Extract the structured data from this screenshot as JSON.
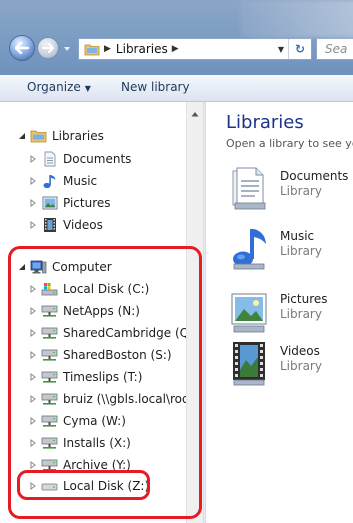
{
  "address": {
    "breadcrumb": "Libraries",
    "search_placeholder": "Sea"
  },
  "toolbar": {
    "organize_label": "Organize",
    "new_library_label": "New library"
  },
  "navigation": {
    "libraries": {
      "label": "Libraries",
      "children": [
        "Documents",
        "Music",
        "Pictures",
        "Videos"
      ]
    },
    "computer": {
      "label": "Computer",
      "drives": [
        "Local Disk (C:)",
        "NetApps (N:)",
        "SharedCambridge (Q:)",
        "SharedBoston (S:)",
        "Timeslips (T:)",
        "bruiz (\\\\gbls.local\\root",
        "Cyma (W:)",
        "Installs (X:)",
        "Archive (Y:)",
        "Local Disk (Z:)"
      ]
    }
  },
  "content": {
    "title": "Libraries",
    "subtitle": "Open a library to see yo",
    "libraries": [
      {
        "name": "Documents",
        "type": "Library",
        "icon": "documents-library-icon"
      },
      {
        "name": "Music",
        "type": "Library",
        "icon": "music-library-icon"
      },
      {
        "name": "Pictures",
        "type": "Library",
        "icon": "pictures-library-icon"
      },
      {
        "name": "Videos",
        "type": "Library",
        "icon": "videos-library-icon"
      }
    ]
  },
  "colors": {
    "highlight": "#e51c23",
    "title_blue": "#1e3287"
  }
}
